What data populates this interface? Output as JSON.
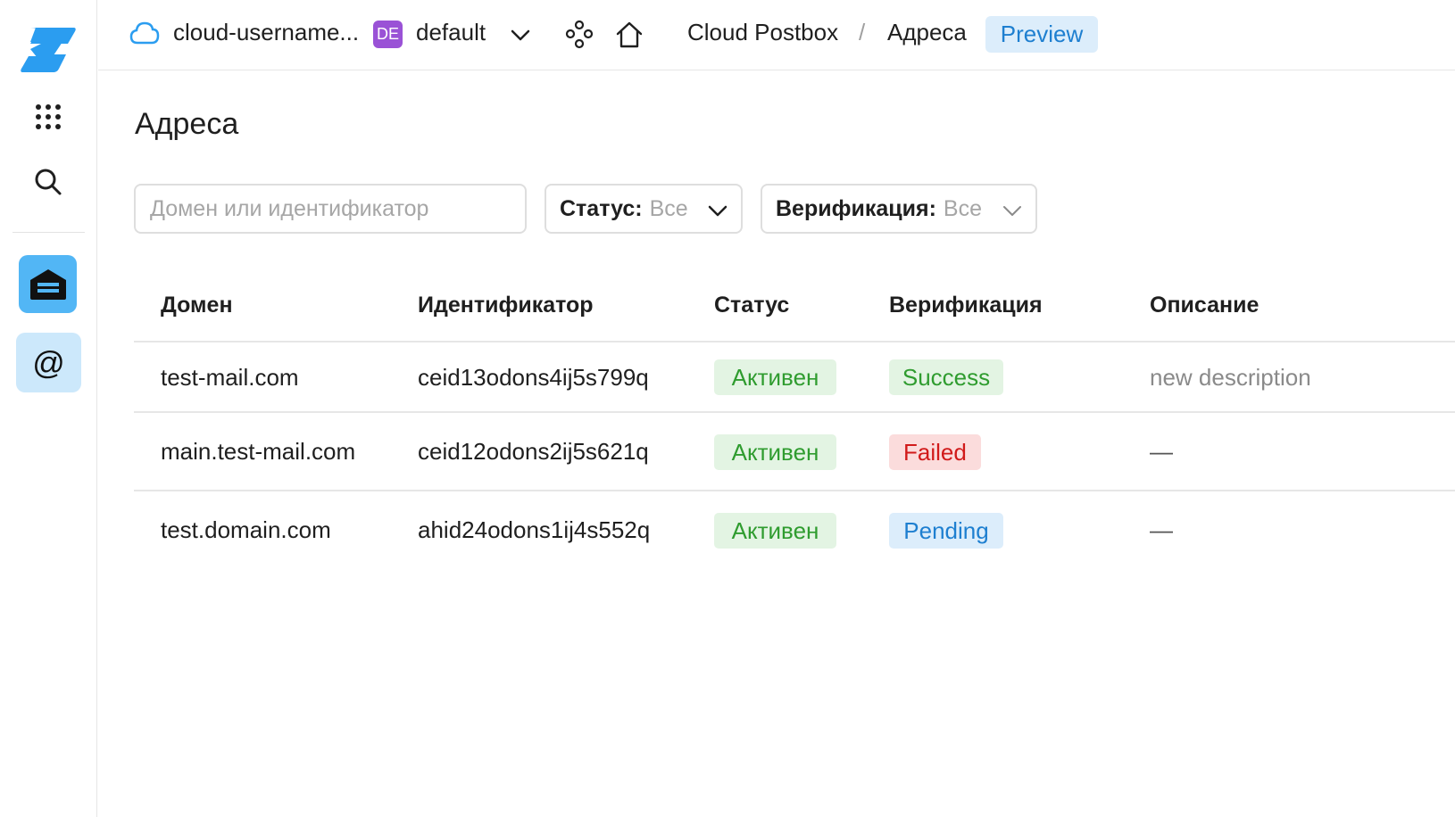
{
  "header": {
    "cloud_name": "cloud-username...",
    "folder_badge": "DE",
    "folder_name": "default",
    "breadcrumb_service": "Cloud Postbox",
    "breadcrumb_separator": "/",
    "breadcrumb_page": "Адреса",
    "preview_label": "Preview"
  },
  "sidebar": {
    "items": [
      "logo-icon",
      "apps-grid-icon",
      "search-icon",
      "postbox-service-icon",
      "address-at-icon"
    ],
    "at_glyph": "@"
  },
  "page": {
    "title": "Адреса"
  },
  "filters": {
    "search_placeholder": "Домен или идентификатор",
    "status_label": "Статус:",
    "status_value": "Все",
    "verification_label": "Верификация:",
    "verification_value": "Все"
  },
  "table": {
    "columns": [
      "Домен",
      "Идентификатор",
      "Статус",
      "Верификация",
      "Описание"
    ],
    "rows": [
      {
        "domain": "test-mail.com",
        "id": "ceid13odons4ij5s799q",
        "status": "Активен",
        "verification": "Success",
        "description": "new description"
      },
      {
        "domain": "main.test-mail.com",
        "id": "ceid12odons2ij5s621q",
        "status": "Активен",
        "verification": "Failed",
        "description": "—"
      },
      {
        "domain": "test.domain.com",
        "id": "ahid24odons1ij4s552q",
        "status": "Активен",
        "verification": "Pending",
        "description": "—"
      }
    ]
  },
  "colors": {
    "accent": "#52b6f5",
    "status_success": "#2f9c2f",
    "status_failed": "#d11a1a",
    "status_pending": "#1e7fd0",
    "folder_badge": "#9a52d6"
  }
}
